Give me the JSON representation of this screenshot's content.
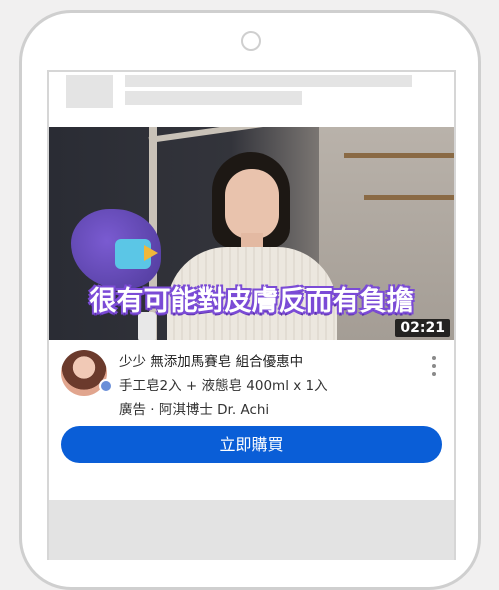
{
  "video": {
    "caption": "很有可能對皮膚反而有負擔",
    "duration": "02:21"
  },
  "ad": {
    "title": "少少 無添加馬賽皂 組合優惠中",
    "subtitle": "手工皂2入 + 液態皂 400ml x 1入",
    "meta": "廣告 · 阿淇博士 Dr. Achi",
    "cta_label": "立即購買"
  },
  "colors": {
    "cta": "#0a5ed7",
    "caption_outline": "#7b4bd6"
  }
}
